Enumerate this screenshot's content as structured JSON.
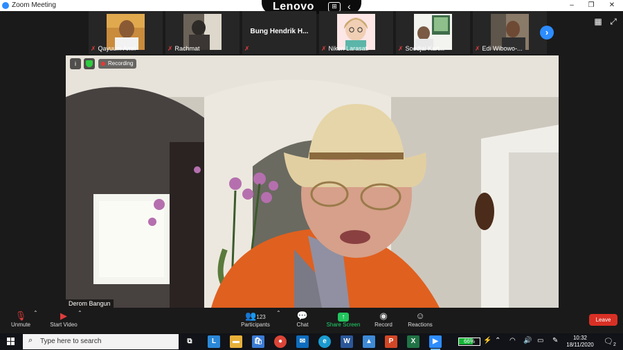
{
  "window": {
    "title": "Zoom Meeting",
    "controls": [
      "–",
      "❐",
      "✕"
    ]
  },
  "lenovo_bar": {
    "brand": "Lenovo",
    "grid_glyph": "⊞",
    "back_glyph": "‹"
  },
  "participants_strip": [
    {
      "name": "Qayuum Amri",
      "muted": true,
      "has_photo": true
    },
    {
      "name": "Rachmat",
      "muted": true,
      "has_photo": true
    },
    {
      "name": "",
      "display": "Bung Hendrik H...",
      "muted": true,
      "has_photo": false
    },
    {
      "name": "Niken Larasati",
      "muted": true,
      "has_photo": true
    },
    {
      "name": "Soedjai Kart...",
      "muted": true,
      "has_photo": true
    },
    {
      "name": "Edi Wibowo-...",
      "muted": true,
      "has_photo": true
    }
  ],
  "view": {
    "next_page_icon": "chevron-right-icon",
    "gallery_icon": "grid-icon",
    "fullscreen_icon": "expand-icon"
  },
  "main_video": {
    "speaker_name": "Derom Bangun",
    "recording_label": "Recording",
    "info_glyph": "i"
  },
  "toolbar": {
    "unmute_label": "Unmute",
    "start_video_label": "Start Video",
    "participants_label": "Participants",
    "participants_count": "123",
    "chat_label": "Chat",
    "share_screen_label": "Share Screen",
    "record_label": "Record",
    "reactions_label": "Reactions",
    "leave_label": "Leave"
  },
  "taskbar": {
    "search_placeholder": "Type here to search",
    "battery_percent": "66%",
    "battery_level": 0.66,
    "time": "10:32",
    "date": "18/11/2020",
    "notification_count": "2"
  },
  "colors": {
    "zoom_blue": "#2d8cff",
    "leave_red": "#d93025",
    "share_green": "#22c55e",
    "muted_red": "#e03c3c"
  }
}
